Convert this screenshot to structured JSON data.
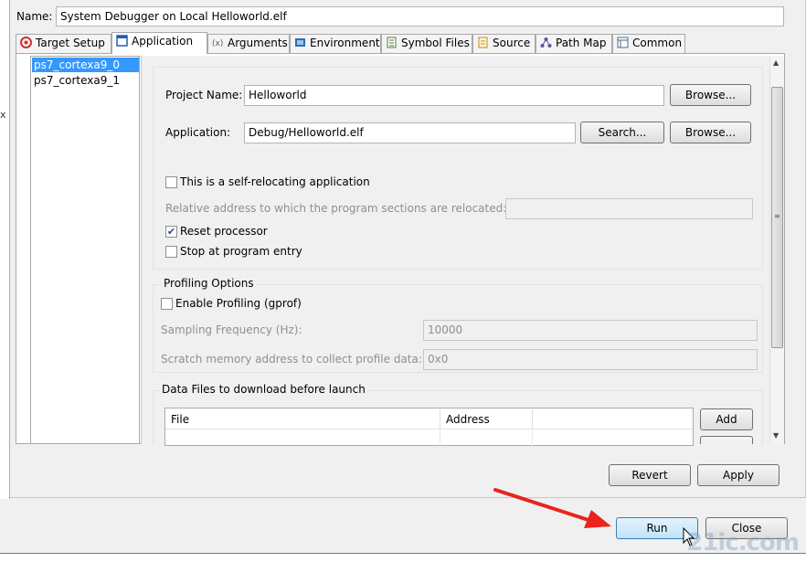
{
  "dialog": {
    "name_label": "Name:",
    "name_value": "System Debugger on Local Helloworld.elf"
  },
  "tabs": [
    {
      "label": "Target Setup",
      "icon": "target-icon",
      "icon_color": "#d23030"
    },
    {
      "label": "Application",
      "icon": "window-icon",
      "icon_color": "#2060b0"
    },
    {
      "label": "Arguments",
      "icon": "arguments-icon",
      "icon_color": "#5a5a5a"
    },
    {
      "label": "Environment",
      "icon": "environment-icon",
      "icon_color": "#2f6fb0"
    },
    {
      "label": "Symbol Files",
      "icon": "symbol-files-icon",
      "icon_color": "#4c7a3a"
    },
    {
      "label": "Source",
      "icon": "source-icon",
      "icon_color": "#c08a20"
    },
    {
      "label": "Path Map",
      "icon": "path-map-icon",
      "icon_color": "#6a4e9a"
    },
    {
      "label": "Common",
      "icon": "common-icon",
      "icon_color": "#4a6a8a"
    }
  ],
  "processors": [
    "ps7_cortexa9_0",
    "ps7_cortexa9_1"
  ],
  "application": {
    "project_name_label": "Project Name:",
    "project_name_value": "Helloworld",
    "application_label": "Application:",
    "application_value": "Debug/Helloworld.elf",
    "browse_label": "Browse...",
    "search_label": "Search...",
    "self_relocating_label": "This is a self-relocating application",
    "self_relocating_checked": false,
    "relative_address_label": "Relative address to which the program sections are relocated:",
    "relative_address_value": "",
    "reset_processor_label": "Reset processor",
    "reset_processor_checked": true,
    "stop_at_entry_label": "Stop at program entry",
    "stop_at_entry_checked": false
  },
  "profiling": {
    "group_title": "Profiling Options",
    "enable_label": "Enable Profiling (gprof)",
    "enable_checked": false,
    "sampling_label": "Sampling Frequency (Hz):",
    "sampling_value": "10000",
    "scratch_label": "Scratch memory address to collect profile data:",
    "scratch_value": "0x0"
  },
  "data_files": {
    "group_title": "Data Files to download before launch",
    "columns": [
      "File",
      "Address",
      ""
    ],
    "add_label": "Add"
  },
  "footer": {
    "revert_label": "Revert",
    "apply_label": "Apply",
    "run_label": "Run",
    "close_label": "Close"
  },
  "overlay": {
    "arrow_color": "#e8241c",
    "watermark": "21ic.com"
  },
  "left_strip": {
    "mark": "x"
  }
}
